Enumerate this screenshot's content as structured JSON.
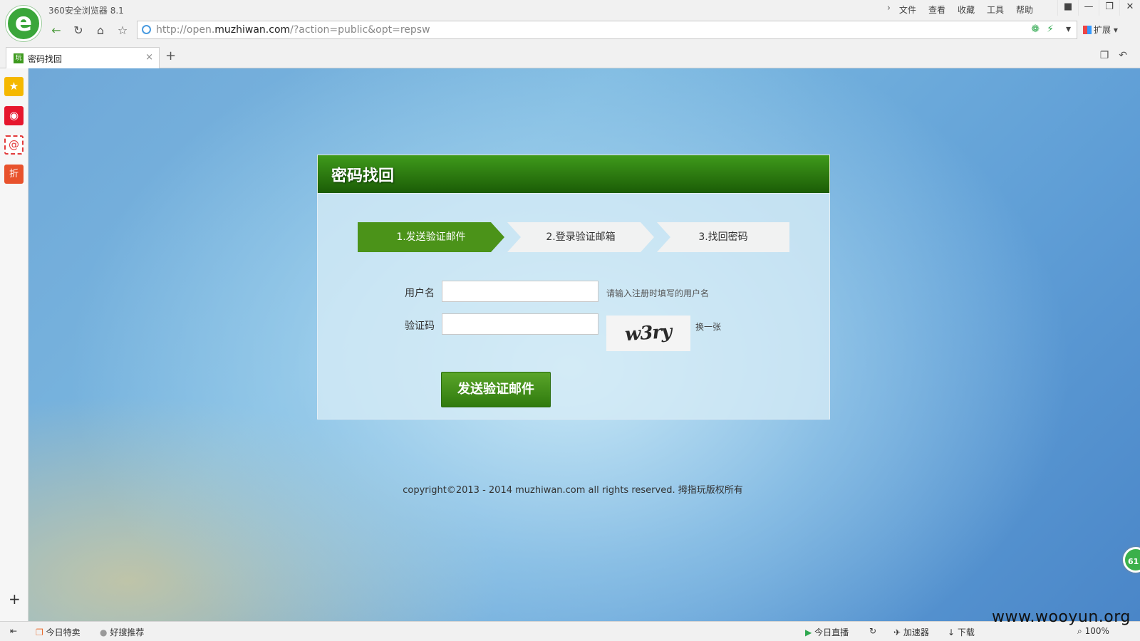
{
  "browser": {
    "app_title": "360安全浏览器 8.1",
    "logo_letter": "e",
    "menus": [
      "文件",
      "查看",
      "收藏",
      "工具",
      "帮助"
    ],
    "menu_chevron": "›",
    "window_buttons": [
      "■",
      "—",
      "❐",
      "✕"
    ],
    "nav": {
      "back": "←",
      "refresh": "↻",
      "home": "⌂",
      "favorite": "☆"
    },
    "url_prefix": "http://open.",
    "url_domain": "muzhiwan.com",
    "url_path": "/?action=public&opt=repsw",
    "extensions_label": "扩展",
    "dropdown_arrow": "▾"
  },
  "tabs": [
    {
      "favicon_text": "玩",
      "title": "密码找回",
      "close": "×"
    }
  ],
  "new_tab": "+",
  "sidebar": {
    "icons": [
      {
        "name": "favorites-star-icon",
        "glyph": "★",
        "color": "#f5b800"
      },
      {
        "name": "weibo-icon",
        "glyph": "◉",
        "color": "#e6162d"
      },
      {
        "name": "mail-icon",
        "glyph": "@",
        "color": "#e23b3b"
      },
      {
        "name": "discount-icon",
        "glyph": "折",
        "color": "#e8522c"
      }
    ],
    "add": "+"
  },
  "page": {
    "title": "密码找回",
    "steps": [
      "1.发送验证邮件",
      "2.登录验证邮箱",
      "3.找回密码"
    ],
    "form": {
      "username_label": "用户名",
      "username_value": "",
      "username_hint": "请输入注册时填写的用户名",
      "captcha_label": "验证码",
      "captcha_value": "",
      "captcha_image_text": "w3ry",
      "captcha_refresh": "换一张"
    },
    "submit_label": "发送验证邮件",
    "copyright": "copyright©2013 - 2014 muzhiwan.com all rights reserved. 拇指玩版权所有",
    "float_badge": "61"
  },
  "statusbar": {
    "left_items": [
      "今日特卖",
      "好搜推荐"
    ],
    "right_items": [
      "今日直播",
      "加速器",
      "下载"
    ],
    "zoom": "100%"
  },
  "watermark": "www.wooyun.org",
  "colors": {
    "accent_green": "#4b9319",
    "header_green_dark": "#1b5c06"
  }
}
